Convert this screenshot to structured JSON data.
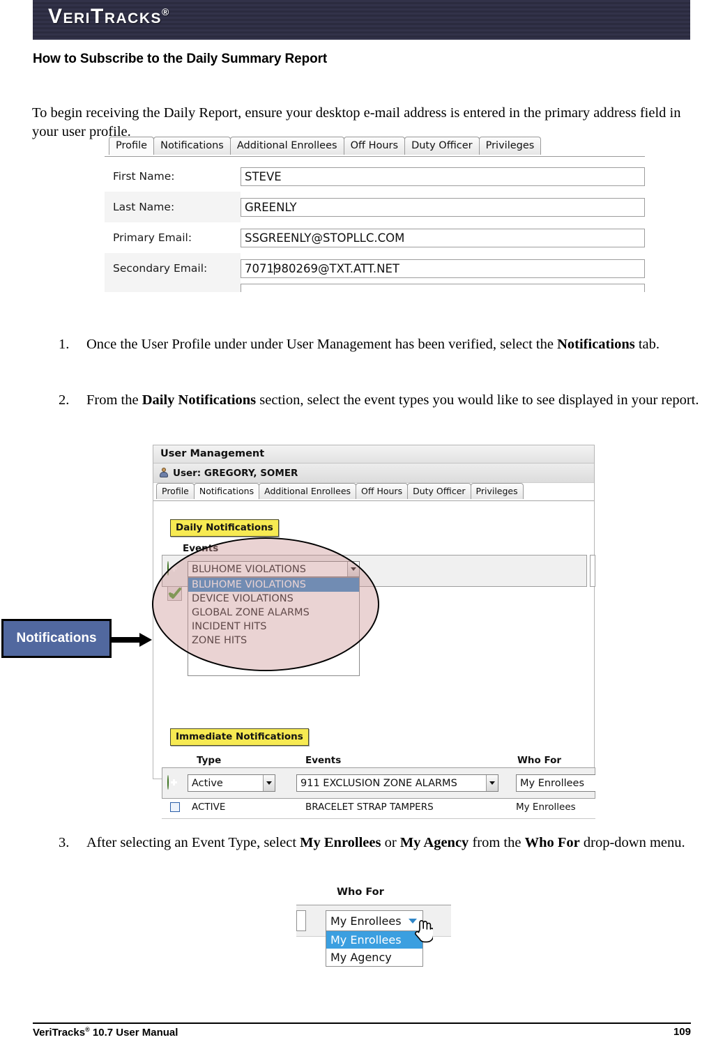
{
  "header": {
    "logo_text": "VeriTracks",
    "logo_trademark": "®"
  },
  "page_heading": "How to Subscribe to the Daily Summary Report",
  "intro_paragraph": "To begin receiving the Daily Report, ensure your desktop e-mail address is entered in the primary address field in your user profile.",
  "steps": [
    {
      "number": "1.",
      "text_before": "Once the User Profile under under User Management has been verified, select the ",
      "bold": "Notifications",
      "text_after": " tab."
    },
    {
      "number": "2.",
      "text_before": "From the ",
      "bold": "Daily Notifications",
      "text_after": " section, select the event types you would like to see displayed in your report."
    },
    {
      "number": "3.",
      "text_before": "After selecting an Event Type, select ",
      "bold": "My Enrollees",
      "text_mid1": " or ",
      "bold2": "My Agency",
      "text_mid2": " from the ",
      "bold3": "Who For",
      "text_after": " drop-down menu."
    }
  ],
  "profile_screenshot": {
    "tabs": [
      {
        "label": "Profile",
        "active": true
      },
      {
        "label": "Notifications",
        "active": false
      },
      {
        "label": "Additional Enrollees",
        "active": false
      },
      {
        "label": "Off Hours",
        "active": false
      },
      {
        "label": "Duty Officer",
        "active": false
      },
      {
        "label": "Privileges",
        "active": false
      }
    ],
    "fields": [
      {
        "label": "First Name:",
        "value": "STEVE"
      },
      {
        "label": "Last Name:",
        "value": "GREENLY"
      },
      {
        "label": "Primary Email:",
        "value": "SSGREENLY@STOPLLC.COM"
      },
      {
        "label": "Secondary Email:",
        "value_pre": "7071",
        "value_post": "980269@TXT.ATT.NET"
      }
    ]
  },
  "usermgmt_screenshot": {
    "panel_title": "User Management",
    "user_label": "User: GREGORY, SOMER",
    "tabs": [
      {
        "label": "Profile",
        "active": false
      },
      {
        "label": "Notifications",
        "active": true
      },
      {
        "label": "Additional Enrollees",
        "active": false
      },
      {
        "label": "Off Hours",
        "active": false
      },
      {
        "label": "Duty Officer",
        "active": false
      },
      {
        "label": "Privileges",
        "active": false
      }
    ],
    "daily_badge": "Daily Notifications",
    "immediate_badge": "Immediate Notifications",
    "events_column_header": "Events",
    "combo_value": "BLUHOME VIOLATIONS",
    "dropdown_options": [
      {
        "label": "BLUHOME VIOLATIONS",
        "selected": true
      },
      {
        "label": "DEVICE VIOLATIONS",
        "selected": false
      },
      {
        "label": "GLOBAL ZONE ALARMS",
        "selected": false
      },
      {
        "label": "INCIDENT HITS",
        "selected": false
      },
      {
        "label": "ZONE HITS",
        "selected": false
      }
    ],
    "immediate_headers": {
      "type": "Type",
      "events": "Events",
      "who_for": "Who For"
    },
    "immediate_new_row": {
      "type": "Active",
      "events": "911 EXCLUSION ZONE ALARMS",
      "who_for": "My Enrollees"
    },
    "immediate_existing_row": {
      "type": "ACTIVE",
      "events": "BRACELET STRAP TAMPERS",
      "who_for": "My Enrollees"
    }
  },
  "callout": {
    "label": "Notifications"
  },
  "whofor_screenshot": {
    "header": "Who For",
    "selected_value": "My Enrollees",
    "options": [
      {
        "label": "My Enrollees",
        "selected": true
      },
      {
        "label": "My Agency",
        "selected": false
      }
    ]
  },
  "footer": {
    "left_text": "VeriTracks",
    "left_trademark": "®",
    "left_suffix": " 10.7 User Manual",
    "page_number": "109"
  },
  "colors": {
    "banner_navy": "#2e2e44",
    "callout_blue": "#51689f",
    "badge_yellow": "#f7ea52",
    "dropdown_select_blue": "#2f86c8",
    "annotation_pink": "#cd9696",
    "green_icon": "#6ab33f"
  }
}
